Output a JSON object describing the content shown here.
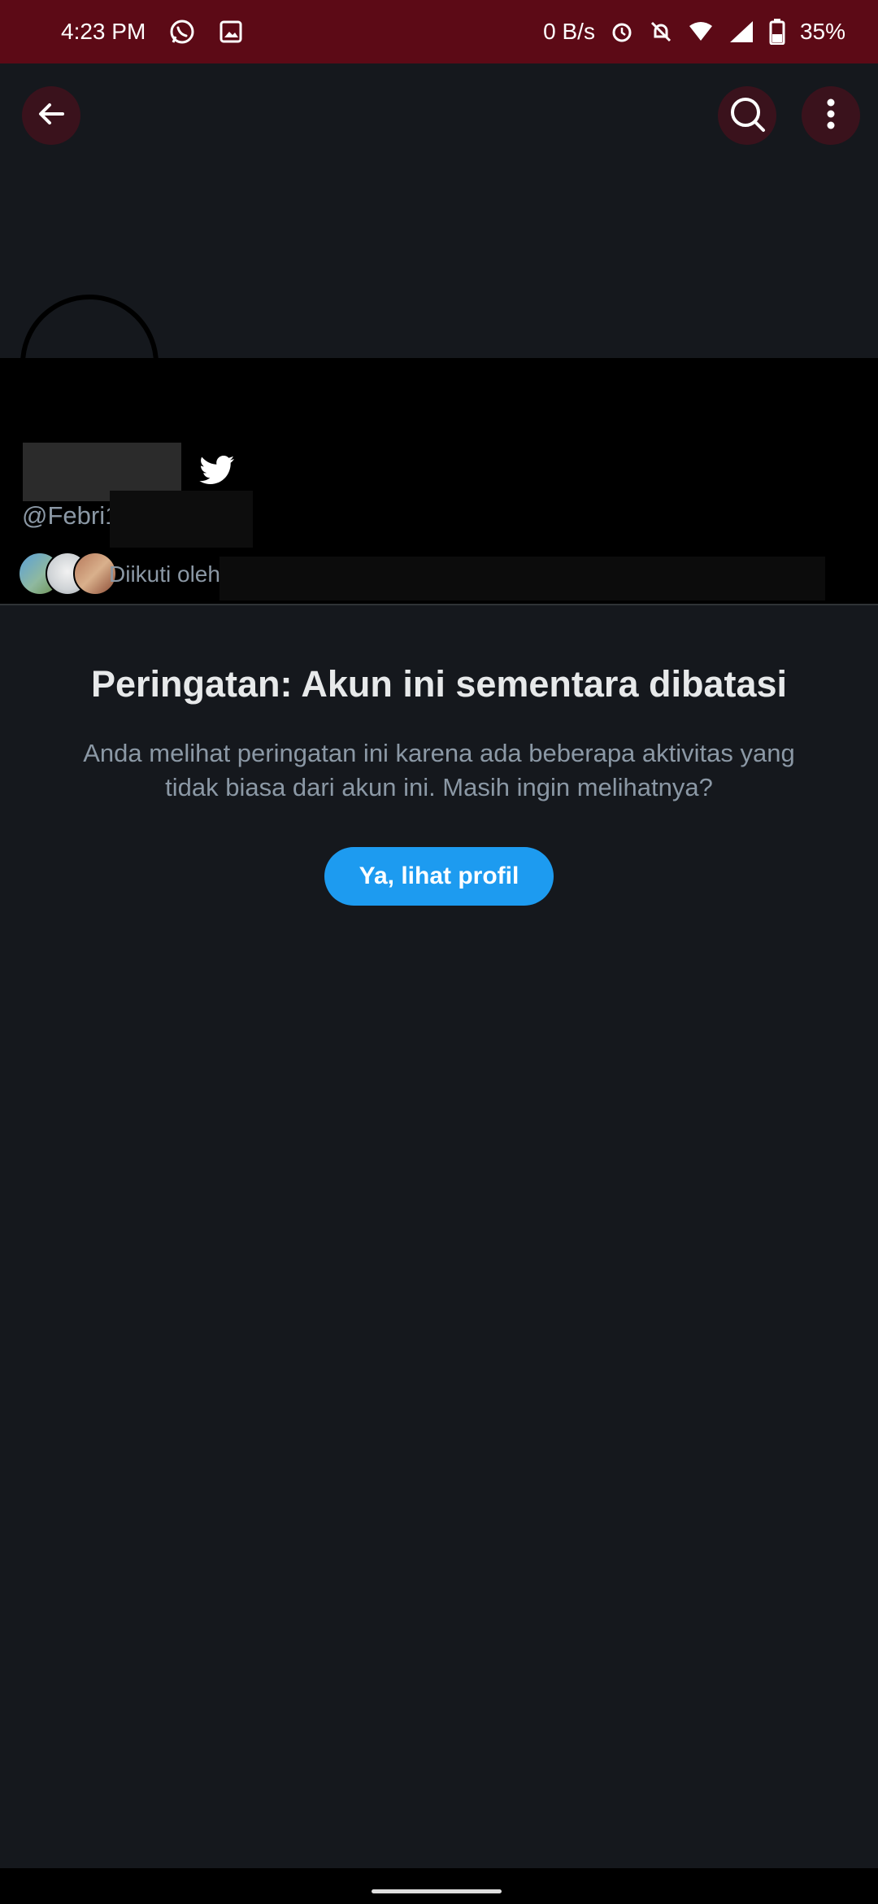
{
  "status_bar": {
    "time": "4:23 PM",
    "net_speed": "0 B/s",
    "battery": "35%",
    "icons": [
      "whatsapp-icon",
      "image-icon",
      "alarm-icon",
      "notifications-off-icon",
      "wifi-icon",
      "signal-icon",
      "battery-icon"
    ]
  },
  "header": {
    "back_icon": "arrow-left-icon",
    "search_icon": "search-icon",
    "more_icon": "more-vertical-icon"
  },
  "profile": {
    "handle": "@Febri1",
    "followed_by": "Diikuti oleh",
    "verified_icon": "twitter-bird-icon"
  },
  "warning": {
    "title": "Peringatan: Akun ini sementara dibatasi",
    "description": "Anda melihat peringatan ini karena ada beberapa aktivitas yang tidak biasa dari akun ini. Masih ingin melihatnya?",
    "button_label": "Ya, lihat profil"
  },
  "colors": {
    "status_bar": "#5c0a16",
    "background": "#15181d",
    "accent": "#1d9bf0",
    "secondary_text": "#8b98a5"
  }
}
